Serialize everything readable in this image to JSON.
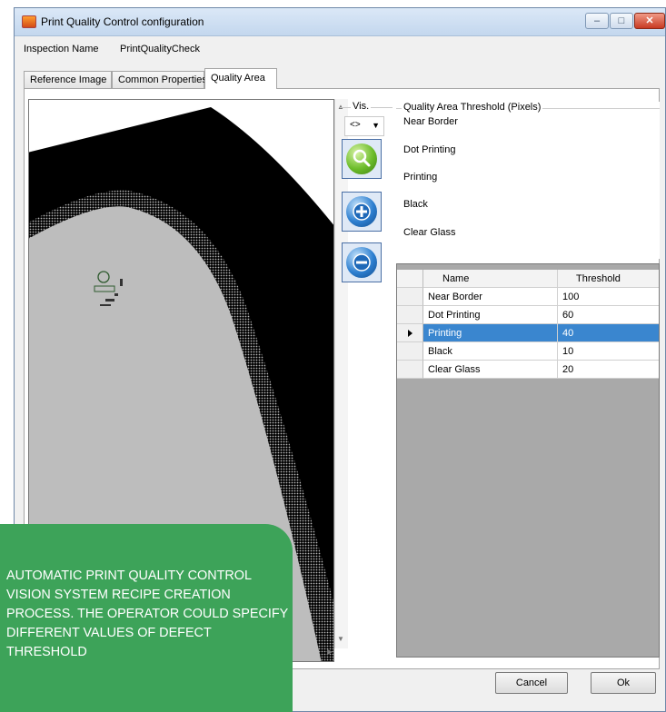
{
  "window": {
    "title": "Print Quality Control configuration",
    "controls": {
      "minimize": "–",
      "maximize": "□",
      "close": "✕"
    }
  },
  "inspection": {
    "label": "Inspection Name",
    "value": "PrintQualityCheck"
  },
  "tabs": [
    {
      "label": "Reference Image",
      "active": false
    },
    {
      "label": "Common Properties",
      "active": false
    },
    {
      "label": "Quality Area",
      "active": true
    }
  ],
  "visibility": {
    "legend": "Vis.",
    "selected": "<>"
  },
  "tools": [
    {
      "name": "zoom",
      "icon": "magnifier-icon"
    },
    {
      "name": "add-area",
      "icon": "plus-icon"
    },
    {
      "name": "remove-area",
      "icon": "minus-icon"
    }
  ],
  "threshold_panel": {
    "legend": "Quality Area Threshold (Pixels)",
    "items": [
      "Near Border",
      "Dot Printing",
      "Printing",
      "Black",
      "Clear Glass"
    ]
  },
  "grid": {
    "headers": {
      "name": "Name",
      "threshold": "Threshold"
    },
    "rows": [
      {
        "name": "Near Border",
        "threshold": "100"
      },
      {
        "name": "Dot Printing",
        "threshold": "60"
      },
      {
        "name": "Printing",
        "threshold": "40"
      },
      {
        "name": "Black",
        "threshold": "10"
      },
      {
        "name": "Clear Glass",
        "threshold": "20"
      }
    ],
    "selected_row": "Printing"
  },
  "buttons": {
    "cancel": "Cancel",
    "ok": "Ok"
  },
  "callout": {
    "text": "AUTOMATIC PRINT QUALITY CONTROL VISION SYSTEM RECIPE CREATION PROCESS. THE OPERATOR COULD SPECIFY DIFFERENT VALUES OF DEFECT THRESHOLD"
  },
  "colors": {
    "selection": "#3a86cf",
    "callout_bg": "#3da359",
    "grid_background": "#a9a9a9"
  }
}
